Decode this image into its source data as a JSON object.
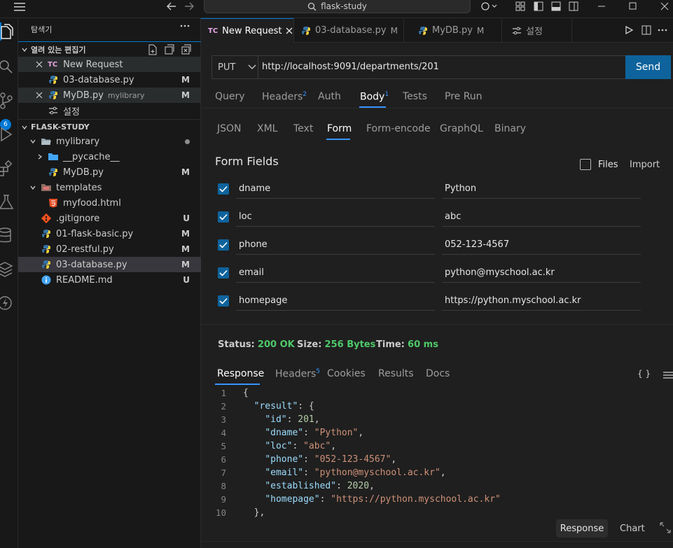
{
  "titlebar": {
    "search_text": "flask-study"
  },
  "activity": {
    "scm_badge": "6"
  },
  "sidebar": {
    "title": "탐색기",
    "open_editors_label": "열려 있는 편집기",
    "open_editors": [
      {
        "name": "New Request",
        "badge": "TC",
        "status": ""
      },
      {
        "name": "03-database.py",
        "status": "M"
      },
      {
        "name": "MyDB.py",
        "desc": "mylibrary",
        "status": "M"
      },
      {
        "name": "설정",
        "status": ""
      }
    ],
    "project_label": "FLASK-STUDY",
    "tree": [
      {
        "name": "mylibrary",
        "status": ""
      },
      {
        "name": "__pycache__",
        "status": ""
      },
      {
        "name": "MyDB.py",
        "status": "M"
      },
      {
        "name": "templates",
        "status": ""
      },
      {
        "name": "myfood.html",
        "status": ""
      },
      {
        "name": ".gitignore",
        "status": "U"
      },
      {
        "name": "01-flask-basic.py",
        "status": "M"
      },
      {
        "name": "02-restful.py",
        "status": "M"
      },
      {
        "name": "03-database.py",
        "status": "M"
      },
      {
        "name": "README.md",
        "status": "U"
      }
    ]
  },
  "tabs": [
    {
      "label": "New Request",
      "badge": "TC",
      "mod": ""
    },
    {
      "label": "03-database.py",
      "mod": "M"
    },
    {
      "label": "MyDB.py",
      "mod": "M"
    },
    {
      "label": "설정",
      "mod": ""
    }
  ],
  "request": {
    "method": "PUT",
    "url": "http://localhost:9091/departments/201",
    "send_label": "Send",
    "tabs": [
      {
        "label": "Query",
        "count": ""
      },
      {
        "label": "Headers",
        "count": "2"
      },
      {
        "label": "Auth",
        "count": ""
      },
      {
        "label": "Body",
        "count": "1"
      },
      {
        "label": "Tests",
        "count": ""
      },
      {
        "label": "Pre Run",
        "count": ""
      }
    ],
    "body_types": [
      "JSON",
      "XML",
      "Text",
      "Form",
      "Form-encode",
      "GraphQL",
      "Binary"
    ],
    "form_title": "Form Fields",
    "files_label": "Files",
    "import_label": "Import",
    "fields": [
      {
        "name": "dname",
        "value": "Python"
      },
      {
        "name": "loc",
        "value": "abc"
      },
      {
        "name": "phone",
        "value": "052-123-4567"
      },
      {
        "name": "email",
        "value": "python@myschool.ac.kr"
      },
      {
        "name": "homepage",
        "value": "https://python.myschool.ac.kr"
      }
    ]
  },
  "response": {
    "status_label": "Status:",
    "status_value": "200 OK",
    "size_label": "Size:",
    "size_value": "256 Bytes",
    "time_label": "Time:",
    "time_value": "60 ms",
    "tabs": [
      {
        "label": "Response",
        "count": ""
      },
      {
        "label": "Headers",
        "count": "5"
      },
      {
        "label": "Cookies",
        "count": ""
      },
      {
        "label": "Results",
        "count": ""
      },
      {
        "label": "Docs",
        "count": ""
      }
    ],
    "braces_label": "{ }",
    "bottom_response": "Response",
    "bottom_chart": "Chart",
    "lines": [
      {
        "n": "1",
        "indent": "",
        "key": "",
        "val": "",
        "type": "",
        "tail": "{"
      },
      {
        "n": "2",
        "indent": "  ",
        "key": "\"result\"",
        "val": "",
        "type": "",
        "tail": ": {"
      },
      {
        "n": "3",
        "indent": "    ",
        "key": "\"id\"",
        "val": "201",
        "type": "n",
        "tail": ","
      },
      {
        "n": "4",
        "indent": "    ",
        "key": "\"dname\"",
        "val": "\"Python\"",
        "type": "s",
        "tail": ","
      },
      {
        "n": "5",
        "indent": "    ",
        "key": "\"loc\"",
        "val": "\"abc\"",
        "type": "s",
        "tail": ","
      },
      {
        "n": "6",
        "indent": "    ",
        "key": "\"phone\"",
        "val": "\"052-123-4567\"",
        "type": "s",
        "tail": ","
      },
      {
        "n": "7",
        "indent": "    ",
        "key": "\"email\"",
        "val": "\"python@myschool.ac.kr\"",
        "type": "s",
        "tail": ","
      },
      {
        "n": "8",
        "indent": "    ",
        "key": "\"established\"",
        "val": "2020",
        "type": "n",
        "tail": ","
      },
      {
        "n": "9",
        "indent": "    ",
        "key": "\"homepage\"",
        "val": "\"https://python.myschool.ac.kr\"",
        "type": "s",
        "tail": ""
      },
      {
        "n": "10",
        "indent": "  ",
        "key": "",
        "val": "",
        "type": "",
        "tail": "},"
      }
    ]
  }
}
